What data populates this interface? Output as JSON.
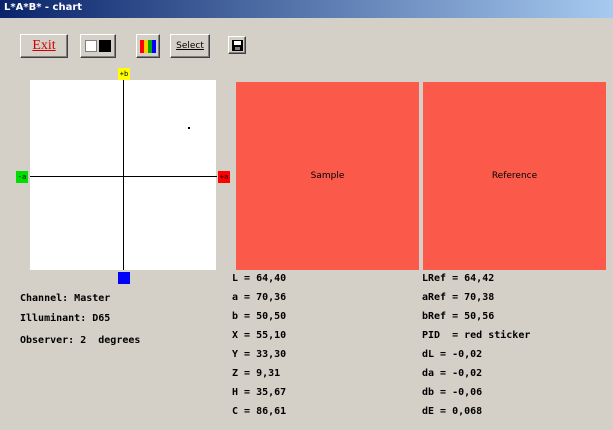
{
  "window": {
    "title": "L*A*B* - chart"
  },
  "toolbar": {
    "exit_label": "Exit",
    "select_label": "Select",
    "bw_icon": "black-white-toggle-icon",
    "color_icon": "color-bars-icon",
    "save_icon": "floppy-disk-icon",
    "color_stripes": [
      "#ff0000",
      "#ffcc00",
      "#00aa00",
      "#0000ff"
    ]
  },
  "plot": {
    "top_marker": "+b",
    "left_marker": "-a",
    "right_marker": "+a",
    "bottom_marker": ""
  },
  "swatches": {
    "sample_label": "Sample",
    "reference_label": "Reference",
    "color": "#fb5a4a"
  },
  "info": {
    "channel": "Channel: Master",
    "illuminant": "Illuminant: D65",
    "observer": "Observer: 2  degrees"
  },
  "sample_values": [
    "L = 64,40",
    "a = 70,36",
    "b = 50,50",
    "X = 55,10",
    "Y = 33,30",
    "Z = 9,31",
    "H = 35,67",
    "C = 86,61"
  ],
  "reference_values": [
    "LRef = 64,42",
    "aRef = 70,38",
    "bRef = 50,56",
    "PID  = red sticker",
    "dL = -0,02",
    "da = -0,02",
    "db = -0,06",
    "dE = 0,068"
  ]
}
